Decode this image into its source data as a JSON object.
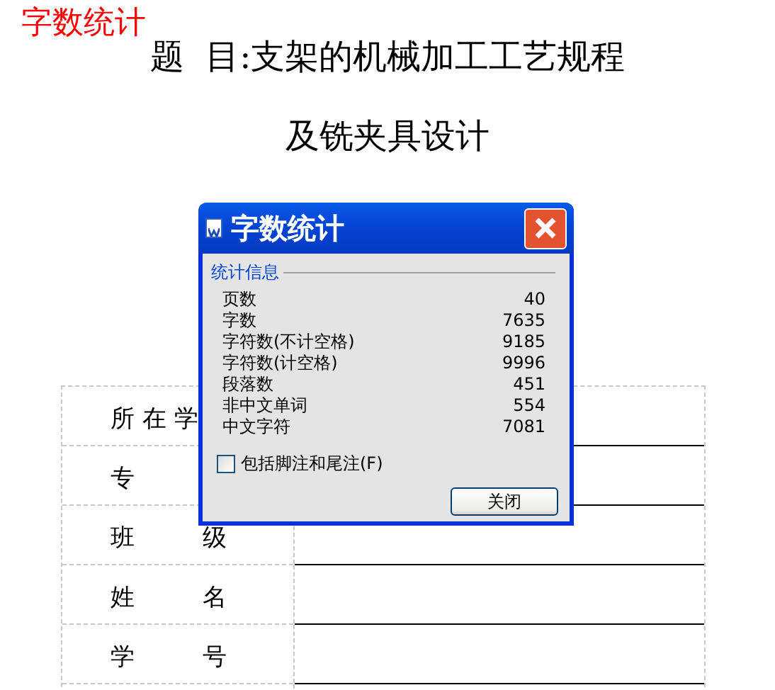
{
  "annotation": {
    "text": "字数统计"
  },
  "document": {
    "title_lines": [
      "题  目:支架的机械加工工艺规程",
      "及铣夹具设计"
    ],
    "table": {
      "rows": [
        {
          "labels": [
            "所 在 学"
          ]
        },
        {
          "labels": [
            "专"
          ]
        },
        {
          "labels": [
            "班",
            "级"
          ]
        },
        {
          "labels": [
            "姓",
            "名"
          ]
        },
        {
          "labels": [
            "学",
            "号"
          ]
        }
      ]
    }
  },
  "dialog": {
    "title": "字数统计",
    "group_label": "统计信息",
    "stats": [
      {
        "label": "页数",
        "value": "40"
      },
      {
        "label": "字数",
        "value": "7635"
      },
      {
        "label": "字符数(不计空格)",
        "value": "9185"
      },
      {
        "label": "字符数(计空格)",
        "value": "9996"
      },
      {
        "label": "段落数",
        "value": "451"
      },
      {
        "label": "非中文单词",
        "value": "554"
      },
      {
        "label": "中文字符",
        "value": "7081"
      }
    ],
    "checkbox": {
      "label": "包括脚注和尾注(F)",
      "checked": false
    },
    "button": "关闭"
  }
}
